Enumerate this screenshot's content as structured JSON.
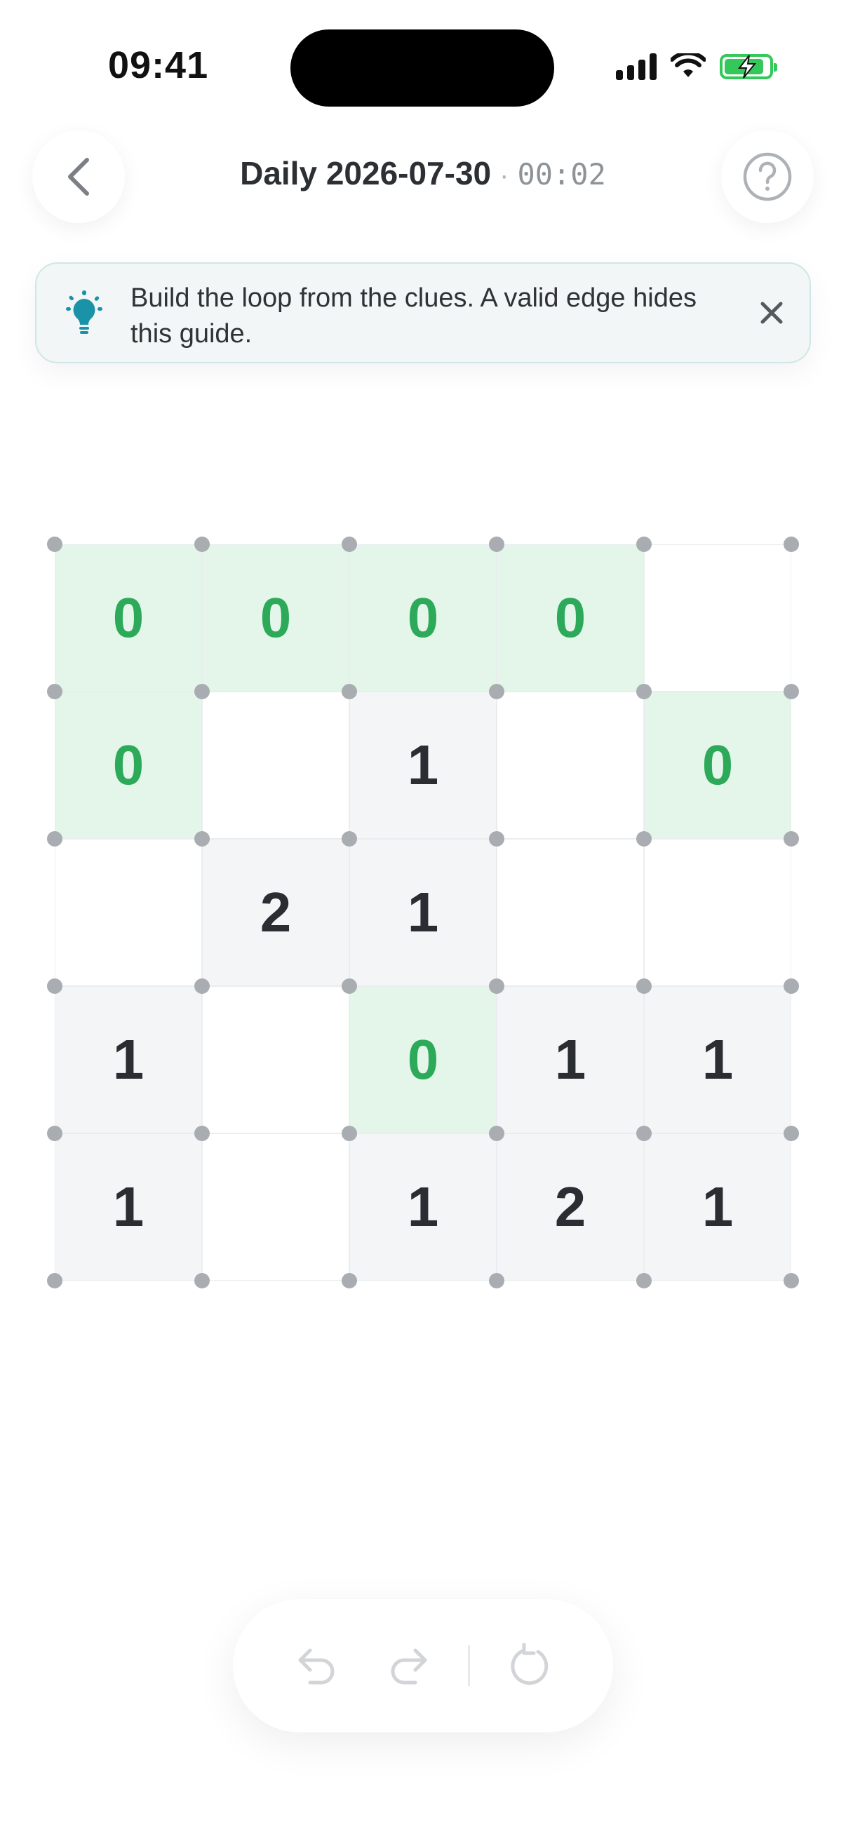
{
  "status_bar": {
    "time": "09:41"
  },
  "header": {
    "title": "Daily 2026-07-30",
    "separator": "·",
    "timer": "00:02"
  },
  "hint": {
    "text": "Build the loop from the clues. A valid edge hides this guide."
  },
  "board": {
    "rows": 5,
    "cols": 5,
    "cells": [
      [
        "0",
        "0",
        "0",
        "0",
        ""
      ],
      [
        "0",
        "",
        "1",
        "",
        "0"
      ],
      [
        "",
        "2",
        "1",
        "",
        ""
      ],
      [
        "1",
        "",
        "0",
        "1",
        "1"
      ],
      [
        "1",
        "",
        "1",
        "2",
        "1"
      ]
    ]
  },
  "colors": {
    "zero_fill": "#e4f5ea",
    "zero_text": "#2caa5a",
    "clue_fill": "#f4f5f7",
    "hint_icon": "#1a93a8",
    "battery": "#34c759"
  },
  "icons": {
    "back": "chevron-left-icon",
    "help": "question-icon",
    "hint": "lightbulb-icon",
    "close": "close-icon",
    "undo": "undo-icon",
    "redo": "redo-icon",
    "reset": "reset-icon"
  }
}
